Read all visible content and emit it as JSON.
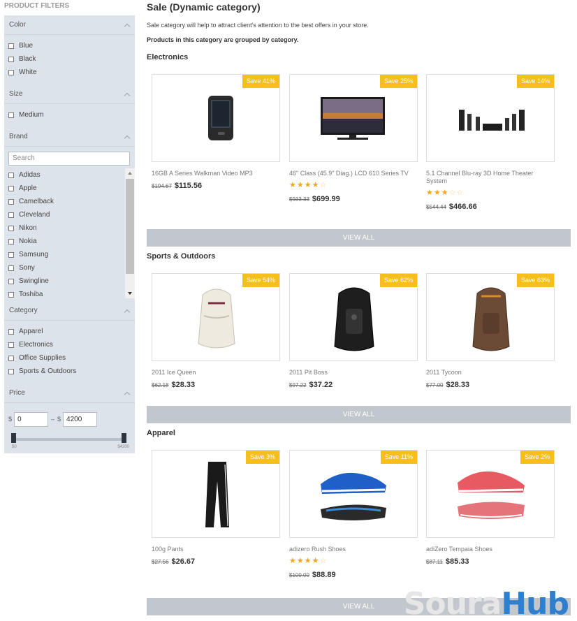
{
  "sidebar": {
    "title": "PRODUCT FILTERS",
    "color": {
      "label": "Color",
      "options": [
        "Blue",
        "Black",
        "White"
      ]
    },
    "size": {
      "label": "Size",
      "options": [
        "Medium"
      ]
    },
    "brand": {
      "label": "Brand",
      "search_placeholder": "Search",
      "options": [
        "Adidas",
        "Apple",
        "Camelback",
        "Cleveland",
        "Nikon",
        "Nokia",
        "Samsung",
        "Sony",
        "Swingline",
        "Toshiba"
      ]
    },
    "category": {
      "label": "Category",
      "options": [
        "Apparel",
        "Electronics",
        "Office Supplies",
        "Sports & Outdoors"
      ]
    },
    "price": {
      "label": "Price",
      "currency": "$",
      "min_value": "0",
      "dash": "–",
      "max_value": "4200",
      "slider_min": "$0",
      "slider_max": "$4200",
      "range": [
        0,
        4200
      ]
    }
  },
  "main": {
    "title": "Sale (Dynamic category)",
    "intro": "Sale category will help to attract client's attention to the best offers in your store.",
    "grouped_note": "Products in this category are grouped by category.",
    "view_all": "VIEW ALL",
    "categories": [
      {
        "name": "Electronics",
        "products": [
          {
            "save": "Save 41%",
            "name": "16GB A Series Walkman Video MP3",
            "old_price": "$194.67",
            "price": "$115.56",
            "rating": null,
            "image_icon": "mp3-player-icon"
          },
          {
            "save": "Save 25%",
            "name": "46\" Class (45.9\" Diag.) LCD 610 Series TV",
            "old_price": "$933.33",
            "price": "$699.99",
            "rating": 4,
            "image_icon": "tv-icon"
          },
          {
            "save": "Save 14%",
            "name": "5.1 Channel Blu-ray 3D Home Theater System",
            "old_price": "$544.44",
            "price": "$466.66",
            "rating": 3,
            "image_icon": "home-theater-icon"
          }
        ]
      },
      {
        "name": "Sports & Outdoors",
        "products": [
          {
            "save": "Save 54%",
            "name": "2011 Ice Queen",
            "old_price": "$62.18",
            "price": "$28.33",
            "rating": null,
            "image_icon": "backpack-white-icon"
          },
          {
            "save": "Save 62%",
            "name": "2011 Pit Boss",
            "old_price": "$97.22",
            "price": "$37.22",
            "rating": null,
            "image_icon": "backpack-black-icon"
          },
          {
            "save": "Save 63%",
            "name": "2011 Tycoon",
            "old_price": "$77.00",
            "price": "$28.33",
            "rating": null,
            "image_icon": "backpack-brown-icon"
          }
        ]
      },
      {
        "name": "Apparel",
        "products": [
          {
            "save": "Save 3%",
            "name": "100g Pants",
            "old_price": "$27.56",
            "price": "$26.67",
            "rating": null,
            "image_icon": "pants-icon"
          },
          {
            "save": "Save 11%",
            "name": "adizero Rush Shoes",
            "old_price": "$100.00",
            "price": "$88.89",
            "rating": 4,
            "image_icon": "blue-shoes-icon"
          },
          {
            "save": "Save 2%",
            "name": "adiZero Tempaia Shoes",
            "old_price": "$87.11",
            "price": "$85.33",
            "rating": null,
            "image_icon": "pink-shoes-icon"
          }
        ]
      }
    ]
  },
  "watermark": {
    "part1": "Soura",
    "part2": "Hub"
  },
  "colors": {
    "badge": "#f6bf1c",
    "view_all_bg": "#c1c7cd",
    "sidebar_bg": "#dde3ea",
    "star": "#f0a818",
    "watermark_blue": "#2f7fcf"
  }
}
